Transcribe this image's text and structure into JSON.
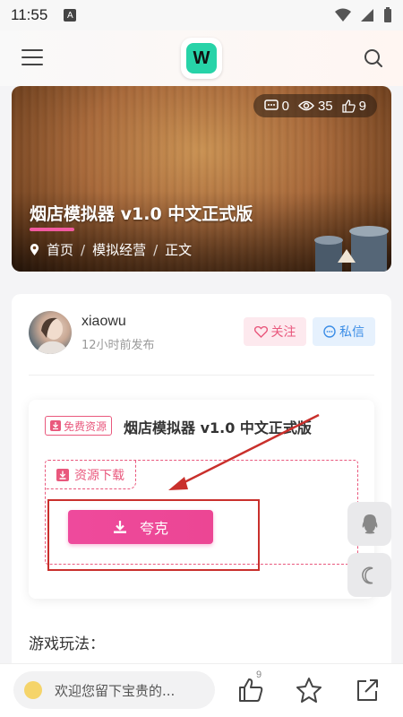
{
  "status_bar": {
    "time": "11:55",
    "notification_letter": "A"
  },
  "header": {
    "logo_letter": "W"
  },
  "hero": {
    "title": "烟店模拟器 v1.0 中文正式版",
    "stats": {
      "comments": "0",
      "views": "35",
      "likes": "9"
    },
    "breadcrumb": [
      "首页",
      "模拟经营",
      "正文"
    ]
  },
  "author": {
    "name": "xiaowu",
    "time": "12小时前发布",
    "follow_label": "关注",
    "message_label": "私信"
  },
  "resource": {
    "tag": "免费资源",
    "title": "烟店模拟器 v1.0 中文正式版",
    "download_label": "资源下载",
    "button_label": "夸克"
  },
  "content": {
    "section_title": "游戏玩法："
  },
  "bottom_bar": {
    "comment_placeholder": "欢迎您留下宝贵的...",
    "like_count": "9"
  },
  "colors": {
    "accent": "#ec4899",
    "follow_bg": "#fde9ee",
    "message_bg": "#e6f1fd",
    "annotation_red": "#c9302c"
  }
}
